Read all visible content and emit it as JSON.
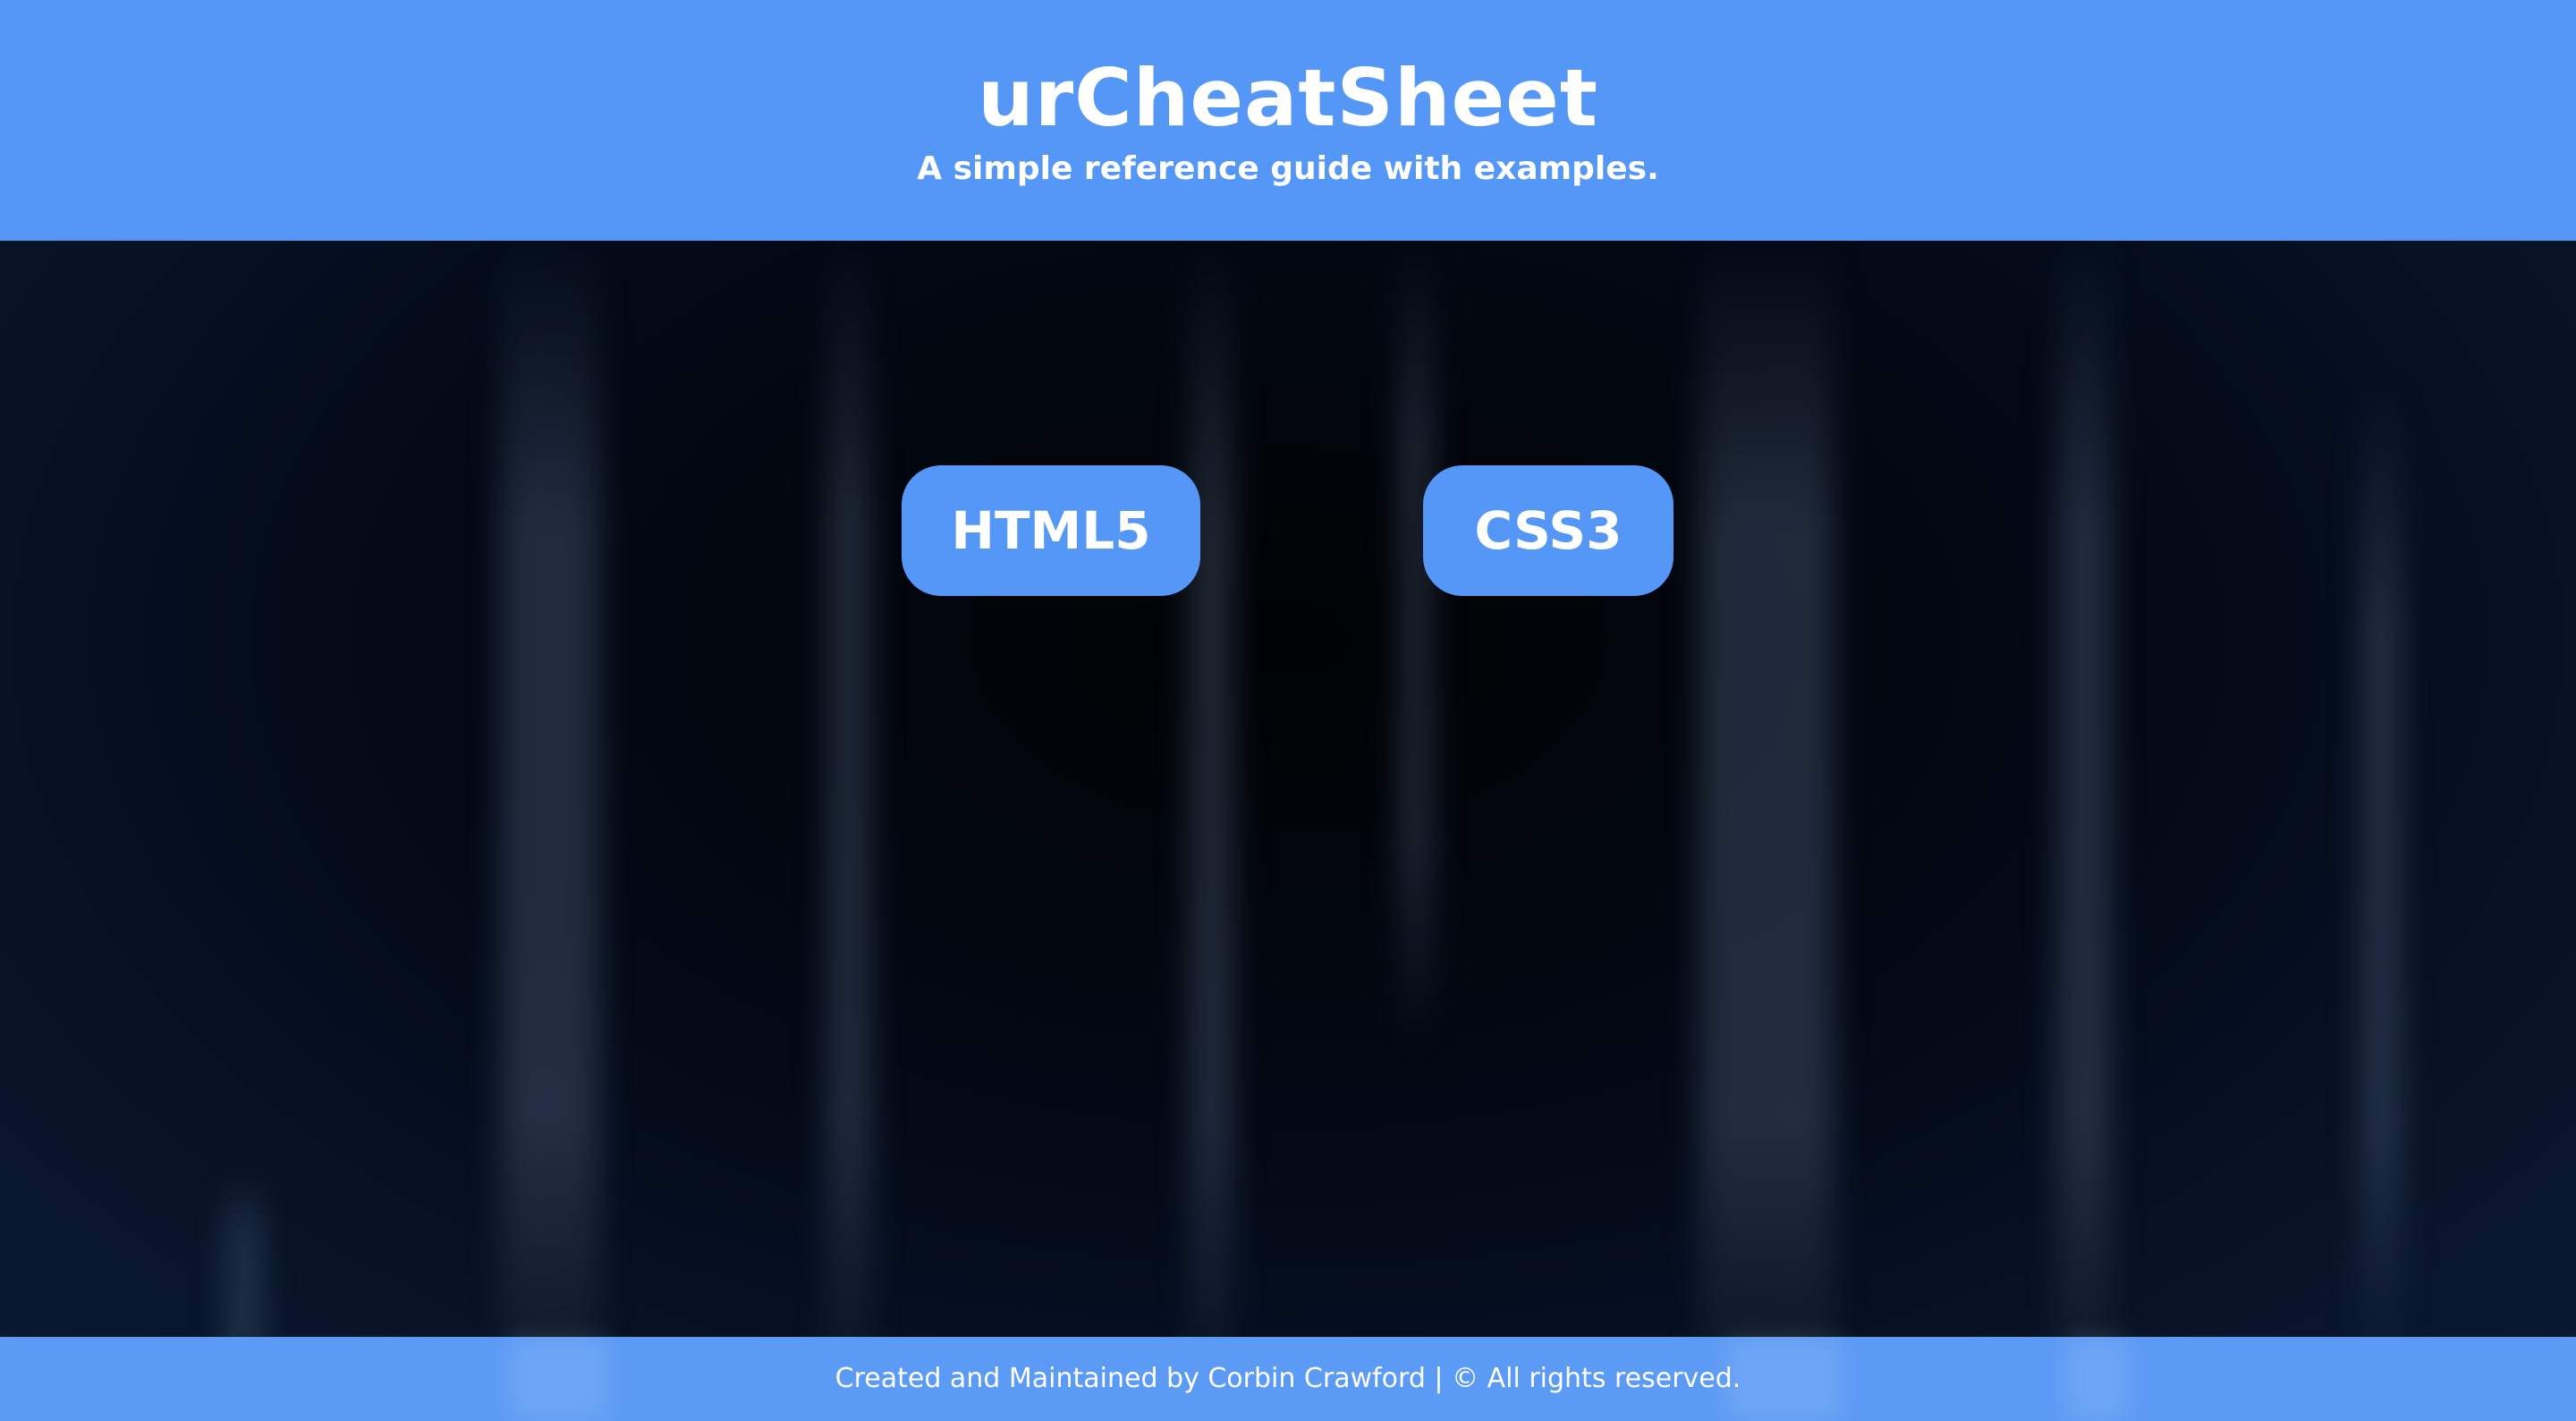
{
  "header": {
    "title": "urCheatSheet",
    "subtitle": "A simple reference guide with examples."
  },
  "nav": {
    "buttons": [
      {
        "label": "HTML5"
      },
      {
        "label": "CSS3"
      }
    ]
  },
  "footer": {
    "text": "Created and Maintained by Corbin Crawford | © All rights reserved."
  },
  "colors": {
    "accent": "#5597f6",
    "background_dark": "#030915",
    "text": "#ffffff"
  }
}
